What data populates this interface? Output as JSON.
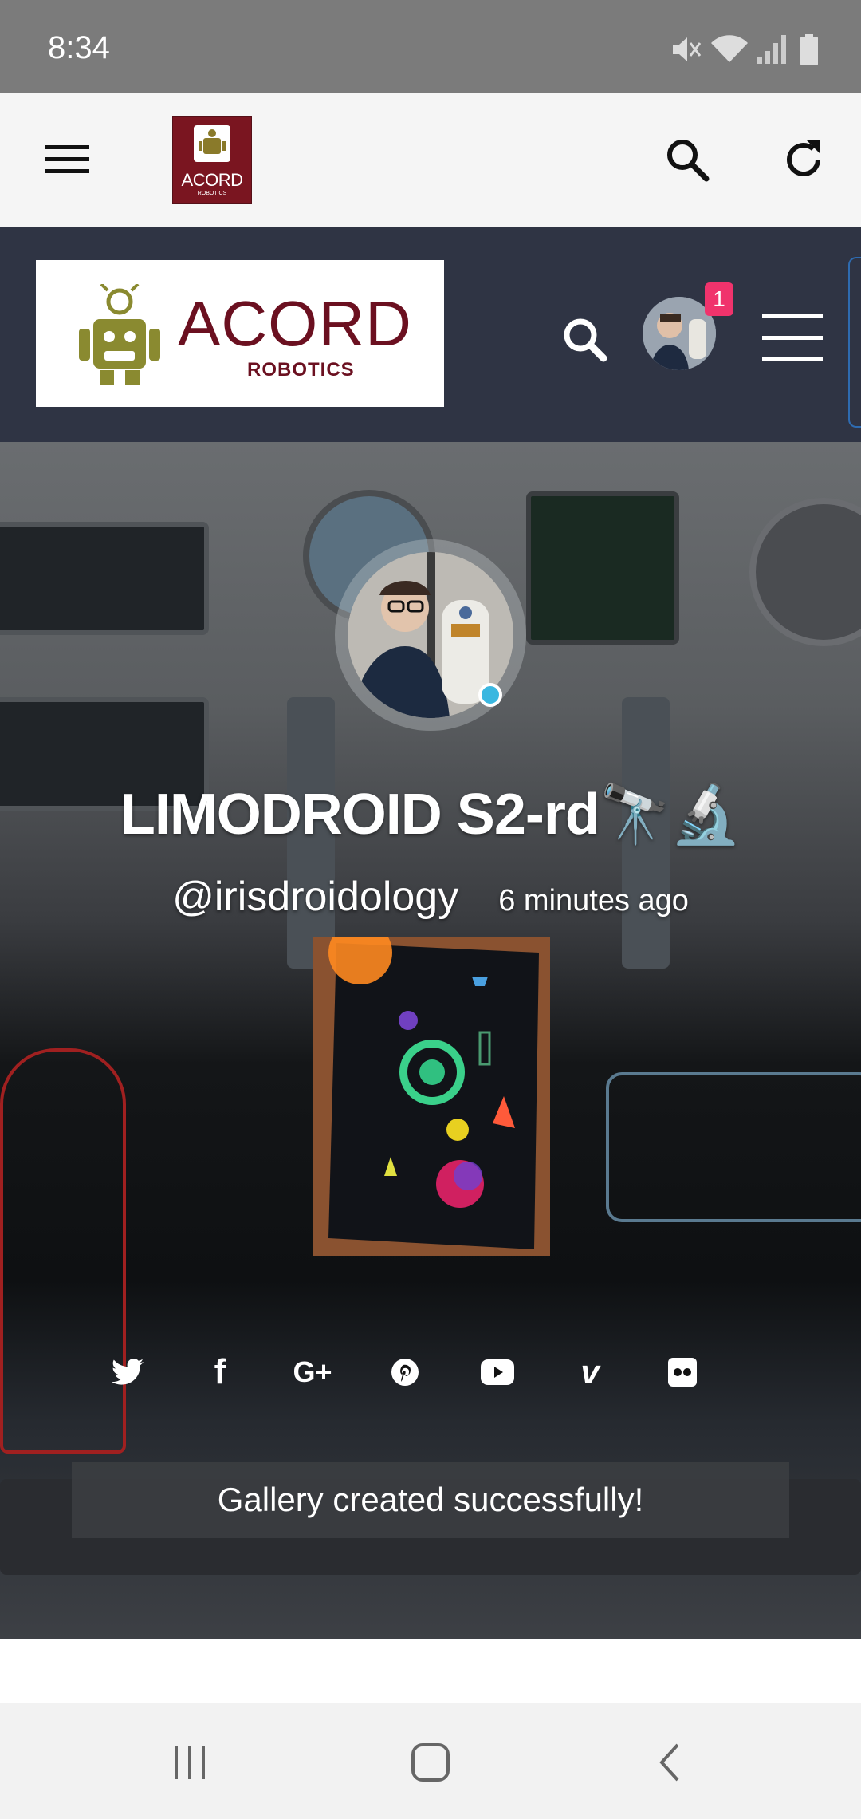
{
  "status_bar": {
    "time": "8:34",
    "icons": [
      "mute-icon",
      "wifi-icon",
      "signal-icon",
      "battery-icon"
    ]
  },
  "toolbar": {
    "menu_icon": "hamburger-icon",
    "logo_text": "ACORD",
    "logo_sub": "ROBOTICS",
    "search_icon": "search-icon",
    "refresh_icon": "refresh-icon"
  },
  "site_header": {
    "brand": "ACORD",
    "brand_sub": "ROBOTICS",
    "notification_count": "1"
  },
  "profile": {
    "name": "LIMODROID S2-rd🔭🔬",
    "handle": "@irisdroidology",
    "time_ago": "6 minutes ago"
  },
  "social_links": [
    "twitter-icon",
    "facebook-icon",
    "google-plus-icon",
    "pinterest-icon",
    "youtube-icon",
    "vimeo-icon",
    "flickr-icon"
  ],
  "social_glyphs": {
    "facebook": "f",
    "google_plus": "G+",
    "vimeo": "v"
  },
  "toast": {
    "message": "Gallery created successfully!"
  },
  "colors": {
    "header_bg": "#2f3444",
    "brand": "#6b1020",
    "badge": "#f0336c",
    "online": "#3ab7e0"
  }
}
